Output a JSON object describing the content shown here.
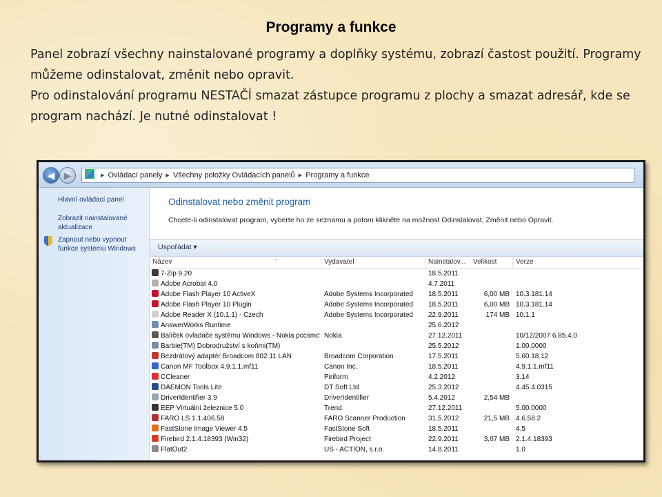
{
  "slide": {
    "title": "Programy a funkce",
    "paragraphs": [
      "Panel zobrazí všechny nainstalované programy a doplňky systému, zobrazí častost použití. Programy můžeme odinstalovat, změnit nebo opravit.",
      "Pro odinstalování programu NESTAČÍ smazat zástupce programu z plochy a smazat adresář, kde se program nachází. Je nutné odinstalovat !"
    ]
  },
  "window": {
    "breadcrumbs": [
      "Ovládací panely",
      "Všechny položky Ovládacích panelů",
      "Programy a funkce"
    ],
    "sidebar": {
      "items": [
        "Hlavní ovládací panel",
        "Zobrazit nainstalované aktualizace",
        "Zapnout nebo vypnout funkce systému Windows"
      ]
    },
    "heading": "Odinstalovat nebo změnit program",
    "description": "Chcete-li odinstalovat program, vyberte ho ze seznamu a potom klikněte na možnost Odinstalovat, Změnit nebo Opravit.",
    "toolbar": {
      "organize": "Uspořádat"
    },
    "columns": [
      "Název",
      "Vydavatel",
      "Nainstalov...",
      "Velikost",
      "Verze"
    ],
    "programs": [
      {
        "name": "7-Zip 9.20",
        "publisher": "",
        "installed": "18.5.2011",
        "size": "",
        "version": "",
        "icon_color": "#3a3a3a"
      },
      {
        "name": "Adobe Acrobat 4.0",
        "publisher": "",
        "installed": "4.7.2011",
        "size": "",
        "version": "",
        "icon_color": "#b0b0b0"
      },
      {
        "name": "Adobe Flash Player 10 ActiveX",
        "publisher": "Adobe Systems Incorporated",
        "installed": "18.5.2011",
        "size": "6,00 MB",
        "version": "10.3.181.14",
        "icon_color": "#c8102e"
      },
      {
        "name": "Adobe Flash Player 10 Plugin",
        "publisher": "Adobe Systems Incorporated",
        "installed": "18.5.2011",
        "size": "6,00 MB",
        "version": "10.3.181.14",
        "icon_color": "#c8102e"
      },
      {
        "name": "Adobe Reader X (10.1.1) - Czech",
        "publisher": "Adobe Systems Incorporated",
        "installed": "22.9.2011",
        "size": "174 MB",
        "version": "10.1.1",
        "icon_color": "#d0d0d0"
      },
      {
        "name": "AnswerWorks Runtime",
        "publisher": "",
        "installed": "25.6.2012",
        "size": "",
        "version": "",
        "icon_color": "#6f8fb0"
      },
      {
        "name": "Balíček ovladače systému Windows - Nokia pccsmcf...",
        "publisher": "Nokia",
        "installed": "27.12.2011",
        "size": "",
        "version": "10/12/2007 6.85.4.0",
        "icon_color": "#5a5a5a"
      },
      {
        "name": "Barbie(TM) Dobrodružství s koňmi(TM)",
        "publisher": "",
        "installed": "25.5.2012",
        "size": "",
        "version": "1.00.0000",
        "icon_color": "#7a8ca8"
      },
      {
        "name": "Bezdrátový adaptér Broadcom 802.11 LAN",
        "publisher": "Broadcom Corporation",
        "installed": "17.5.2011",
        "size": "",
        "version": "5.60.18.12",
        "icon_color": "#c0392b"
      },
      {
        "name": "Canon MF Toolbox 4.9.1.1.mf11",
        "publisher": "Canon Inc.",
        "installed": "18.5.2011",
        "size": "",
        "version": "4.9.1.1.mf11",
        "icon_color": "#3366cc"
      },
      {
        "name": "CCleaner",
        "publisher": "Piriform",
        "installed": "4.2.2012",
        "size": "",
        "version": "3.14",
        "icon_color": "#d9342b"
      },
      {
        "name": "DAEMON Tools Lite",
        "publisher": "DT Soft Ltd",
        "installed": "25.3.2012",
        "size": "",
        "version": "4.45.4.0315",
        "icon_color": "#2b4c8c"
      },
      {
        "name": "DriverIdentifier 3.9",
        "publisher": "DriverIdentifier",
        "installed": "5.4.2012",
        "size": "2,54 MB",
        "version": "",
        "icon_color": "#9aa5b1"
      },
      {
        "name": "EEP Virtuální železnice 5.0",
        "publisher": "Trend",
        "installed": "27.12.2011",
        "size": "",
        "version": "5.00.0000",
        "icon_color": "#333333"
      },
      {
        "name": "FARO LS 1.1.406.58",
        "publisher": "FARO Scanner Production",
        "installed": "31.5.2012",
        "size": "21,5 MB",
        "version": "4.6.58.2",
        "icon_color": "#b03030"
      },
      {
        "name": "FastStone Image Viewer 4.5",
        "publisher": "FastStone Soft",
        "installed": "18.5.2011",
        "size": "",
        "version": "4.5",
        "icon_color": "#e07020"
      },
      {
        "name": "Firebird 2.1.4.18393 (Win32)",
        "publisher": "Firebird Project",
        "installed": "22.9.2011",
        "size": "3,07 MB",
        "version": "2.1.4.18393",
        "icon_color": "#d04020"
      },
      {
        "name": "FlatOut2",
        "publisher": "US - ACTION, s.r.o.",
        "installed": "14.8.2011",
        "size": "",
        "version": "1.0",
        "icon_color": "#8a8a8a"
      }
    ]
  }
}
